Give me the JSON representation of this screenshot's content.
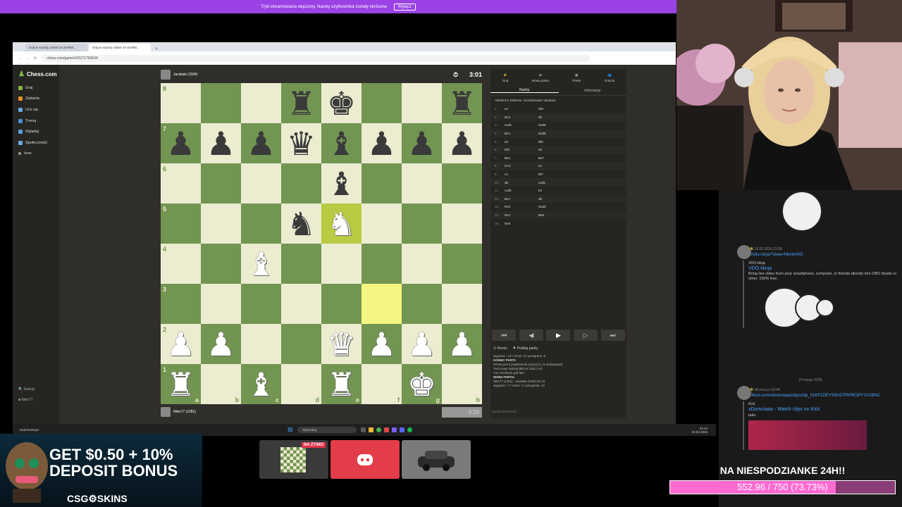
{
  "stream_banner": {
    "text": "Tryb streamowania włączony. Nazwy użytkownika zostały skrócone.",
    "button": "Wyłącz"
  },
  "browser": {
    "tabs": [
      "Graj w szachy online ZA DARM...",
      "Graj w szachy online ZA DARM..."
    ],
    "url": "chess.com/game/165171760034"
  },
  "nav": {
    "logo": "Chess.com",
    "items": [
      "Graj",
      "Zadania",
      "Ucz się",
      "Trenuj",
      "Oglądaj",
      "Społeczność",
      "Inne"
    ],
    "search": "Szukaj",
    "user": "Niter77"
  },
  "top_player": {
    "name": "Jarakala (1184)",
    "clock": "3:01"
  },
  "bottom_player": {
    "name": "Niter77 (1281)",
    "clock": "3:29"
  },
  "board": {
    "ranks": [
      "8",
      "7",
      "6",
      "5",
      "4",
      "3",
      "2",
      "1"
    ],
    "files": [
      "a",
      "b",
      "c",
      "d",
      "e",
      "f",
      "g",
      "h"
    ],
    "rows": [
      [
        "",
        "",
        "",
        "bR",
        "bK",
        "",
        "",
        "bR"
      ],
      [
        "bP",
        "bP",
        "bP",
        "bQ",
        "bB",
        "bP",
        "bP",
        "bP"
      ],
      [
        "",
        "",
        "",
        "",
        "bB",
        "",
        "",
        ""
      ],
      [
        "",
        "",
        "",
        "bN",
        "wN*",
        "",
        "",
        ""
      ],
      [
        "",
        "",
        "wB",
        "",
        "",
        "",
        "",
        ""
      ],
      [
        "",
        "",
        "",
        "",
        "",
        "hl",
        "",
        ""
      ],
      [
        "wP",
        "wP",
        "",
        "",
        "wQ",
        "wP",
        "wP",
        "wP"
      ],
      [
        "wR",
        "",
        "wB",
        "",
        "wR",
        "",
        "wK",
        ""
      ]
    ]
  },
  "right_panel": {
    "tabs": [
      "Graj",
      "Nowa partia",
      "Partie",
      "Gracze"
    ],
    "subtabs": [
      "Ruchy",
      "Informacje"
    ],
    "opening": "Alekhine's Defense: Scandinavian Variation",
    "moves": [
      [
        "1.",
        "e4",
        "Nf6"
      ],
      [
        "2.",
        "Nc3",
        "d5"
      ],
      [
        "3.",
        "exd5",
        "Nxd5"
      ],
      [
        "4.",
        "Bc4",
        "Nxd5"
      ],
      [
        "5.",
        "d4",
        "Bf5"
      ],
      [
        "6.",
        "Nf3",
        "e6"
      ],
      [
        "7.",
        "Be2",
        "Be7"
      ],
      [
        "8.",
        "O-O",
        "c6"
      ],
      [
        "9.",
        "c4",
        "Bf7"
      ],
      [
        "10.",
        "d5",
        "exd5"
      ],
      [
        "11.",
        "cxd5",
        "b4"
      ],
      [
        "12.",
        "Bc4",
        "d5"
      ],
      [
        "13.",
        "Re2",
        "Nxd5"
      ],
      [
        "14.",
        "Re1",
        "Be6"
      ],
      [
        "15.",
        "Ne5",
        ""
      ]
    ],
    "nav_buttons": [
      "⏮",
      "◀",
      "▶",
      "▷",
      "⏭"
    ],
    "draw_label": "Remis",
    "resign_label": "Poddaj partię",
    "chat_lines": [
      "wygrana + 12 / remis +2 / przegrana -8",
      "KONIEC PARTII",
      "Remis przez powtórzenie pozycji (1 | 5 rankingowa)",
      "Twój nowy ranking Blitz to 1281 (+2).",
      "Czy JACM115 grał fair?",
      "NOWA PARTIA",
      "Niter77 (1281) - Jarakala (1184) (5 | 5)",
      "wygrana + 7 / remis -3 / przegrana -12"
    ],
    "chat_placeholder": "Wyślij wiadomość..."
  },
  "taskbar": {
    "weather": "Nadchodzące",
    "search": "Wyszukaj",
    "time": "04:43",
    "date": "23.02.2026"
  },
  "chat": {
    "msg1": {
      "user": "Zyniak",
      "date": "23.02.2026 23:38",
      "link": "https://vdo.ninja/?view=HkmkVhD",
      "site": "VDO.Ninja",
      "title": "VDO.Ninja",
      "desc": "Bring live video from your smartphone, computer, or friends directly into OBS Studio or other. 100% free."
    },
    "separator": "24 lutego 2026",
    "msg2": {
      "user": "Zyniak",
      "date": "Wczoraj o 02:44",
      "link": "https://kick.com/xdomciaaa/clips/clip_01KF1DEYS5H37PKRE3PY1V1BNC",
      "site": "Kick",
      "title": "xDomciaaa - Watch clips on Kick",
      "desc": "taku"
    }
  },
  "ad": {
    "text1": "GET $0.50 + 10%",
    "text2": "DEPOSIT BONUS",
    "brand": "CSG⚙SKINS"
  },
  "live_badge": "NA ŻYWO",
  "goal": {
    "title": "NA NIESPODZIANKE 24H!!",
    "text": "552.96 / 750 (73.73%)",
    "progress": 0.7373
  },
  "colors": {
    "stream_bar": "#9b42e6",
    "board_light": "#ebecd0",
    "board_dark": "#739552",
    "highlight": "#f5f682",
    "discord": "#e23d48",
    "goal_fill": "#ff6ad1"
  }
}
